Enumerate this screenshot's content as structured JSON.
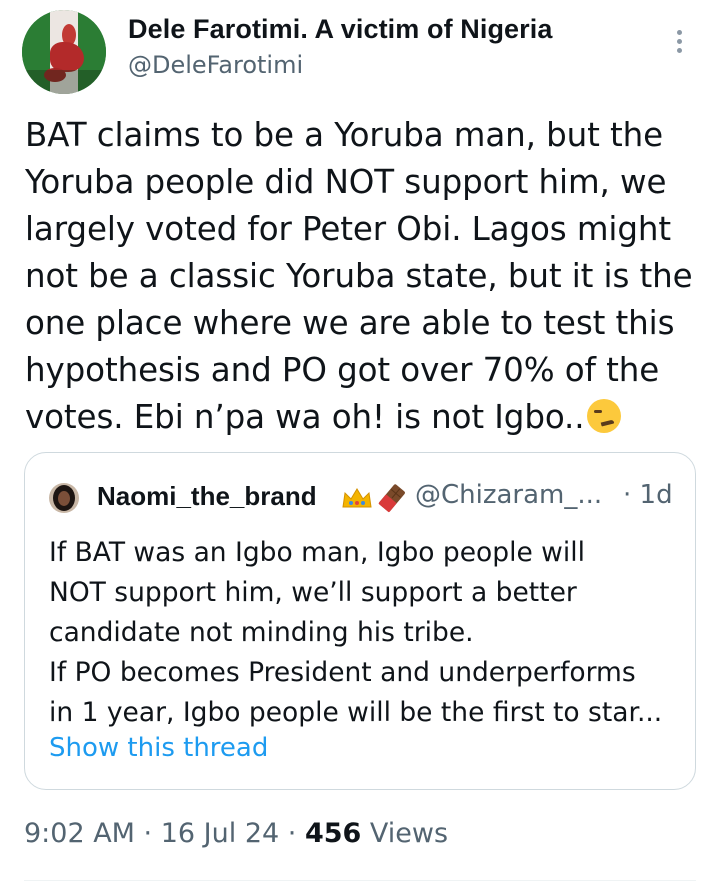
{
  "author": {
    "name": "Dele Farotimi. A victim of Nigeria",
    "handle": "@DeleFarotimi"
  },
  "tweet": {
    "text_lines": [
      "BAT claims to be a Yoruba man, but the",
      "Yoruba people did NOT support him, we",
      "largely voted for Peter Obi. Lagos might",
      "not be a classic Yoruba state, but it is the",
      "one place where we are able to test this",
      "hypothesis and PO got over 70% of the",
      "votes. Ebi n’pa wa oh! is not Igbo.."
    ],
    "trailing_emoji": "smirking-face"
  },
  "quoted_tweet": {
    "name": "Naomi_the_brand",
    "name_emojis": [
      "crown",
      "chocolate-bar"
    ],
    "handle": "@Chizaram_...",
    "time": "· 1d",
    "text_lines": [
      "If BAT was an Igbo man, Igbo people will",
      "NOT support him, we’ll support a better",
      "candidate not minding his tribe.",
      "If PO becomes President and underperforms",
      "in 1 year, Igbo people will be the first to star..."
    ],
    "show_thread_label": "Show this thread"
  },
  "meta": {
    "time": "9:02 AM · 16 Jul 24 · ",
    "views_count": "456",
    "views_label": " Views"
  },
  "colors": {
    "text": "#0f1419",
    "secondary": "#536471",
    "link": "#1d9bf0",
    "border": "#cfd9de"
  }
}
